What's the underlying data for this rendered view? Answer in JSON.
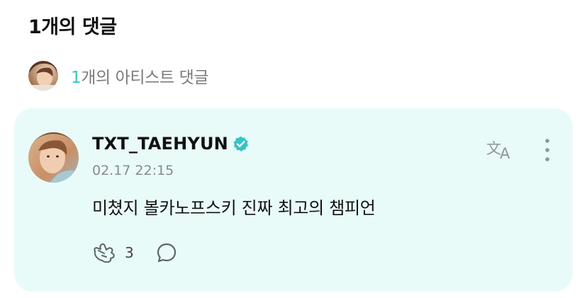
{
  "header": {
    "title": "1개의 댓글"
  },
  "artist_summary": {
    "count": "1",
    "label": "개의 아티스트 댓글"
  },
  "comment": {
    "author": "TXT_TAEHYUN",
    "timestamp": "02.17 22:15",
    "text": "미쳤지 볼카노프스키 진짜 최고의 챔피언",
    "cheer_count": "3",
    "verified": true
  },
  "icons": {
    "verified": "verified-badge-icon",
    "translate": "translate-icon",
    "more": "more-vertical-icon",
    "cheer": "cheer-hand-icon",
    "reply": "speech-bubble-icon"
  },
  "colors": {
    "accent": "#38c3c4",
    "card_background": "#e9fbf9",
    "secondary_text": "#8a8a8a"
  }
}
